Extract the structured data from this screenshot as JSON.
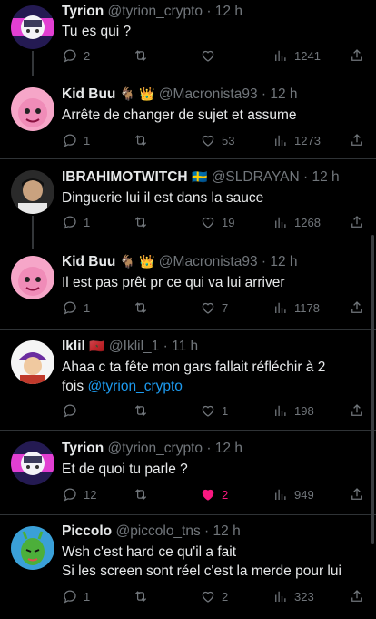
{
  "colors": {
    "background": "#000000",
    "text": "#e7e9ea",
    "muted": "#71767b",
    "link": "#1d9bf0",
    "like": "#f91880",
    "divider": "#2f3336"
  },
  "tweets": [
    {
      "name": "Tyrion",
      "handle": "@tyrion_crypto",
      "sep": "·",
      "time": "12 h",
      "text": "Tu es qui ?",
      "replies": "2",
      "retweets": "",
      "likes": "",
      "views": "1241",
      "liked": false
    },
    {
      "name": "Kid Buu",
      "badges": "🐐 👑",
      "handle": "@Macronista93",
      "sep": "·",
      "time": "12 h",
      "text": "Arrête de changer de sujet et assume",
      "replies": "1",
      "retweets": "",
      "likes": "53",
      "views": "1273",
      "liked": false
    },
    {
      "name": "IBRAHIMOTWITCH",
      "badges": "🇸🇪",
      "handle": "@SLDRAYAN",
      "sep": "·",
      "time": "12 h",
      "text": "Dinguerie lui il est dans la sauce",
      "replies": "1",
      "retweets": "",
      "likes": "19",
      "views": "1268",
      "liked": false
    },
    {
      "name": "Kid Buu",
      "badges": "🐐 👑",
      "handle": "@Macronista93",
      "sep": "·",
      "time": "12 h",
      "text": "Il est pas prêt pr ce qui va lui arriver",
      "replies": "1",
      "retweets": "",
      "likes": "7",
      "views": "1178",
      "liked": false
    },
    {
      "name": "Iklil",
      "badges": "🇲🇦",
      "handle": "@Iklil_1",
      "sep": "·",
      "time": "11 h",
      "text_line1": "Ahaa c ta fête mon gars fallait réfléchir à 2",
      "text_line2": "fois",
      "mention": "@tyrion_crypto",
      "replies": "",
      "retweets": "",
      "likes": "1",
      "views": "198",
      "liked": false
    },
    {
      "name": "Tyrion",
      "handle": "@tyrion_crypto",
      "sep": "·",
      "time": "12 h",
      "text": "Et de quoi tu parle ?",
      "replies": "12",
      "retweets": "",
      "likes": "2",
      "views": "949",
      "liked": true
    },
    {
      "name": "Piccolo",
      "handle": "@piccolo_tns",
      "sep": "·",
      "time": "12 h",
      "text_line1": "Wsh c'est hard ce qu'il a fait",
      "text_line2": "Si les screen sont réel c'est la merde pour lui",
      "replies": "1",
      "retweets": "",
      "likes": "2",
      "views": "323",
      "liked": false
    }
  ]
}
